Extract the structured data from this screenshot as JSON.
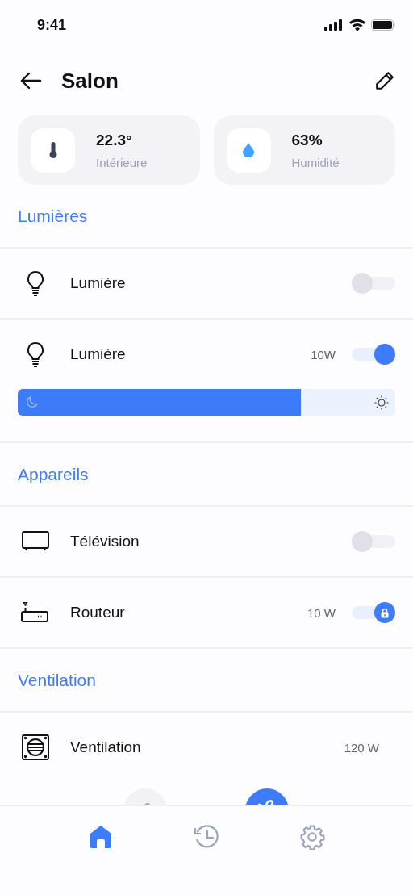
{
  "status_bar": {
    "time": "9:41"
  },
  "header": {
    "title": "Salon"
  },
  "stats": [
    {
      "kind": "temperature",
      "value": "22.3°",
      "label": "Intérieure"
    },
    {
      "kind": "humidity",
      "value": "63%",
      "label": "Humidité"
    }
  ],
  "sections": [
    {
      "title": "Lumières",
      "devices": [
        {
          "kind": "light",
          "name": "Lumière",
          "on": false
        },
        {
          "kind": "light",
          "name": "Lumière",
          "power": "10W",
          "on": true,
          "brightness": {
            "level": 0.75
          }
        }
      ]
    },
    {
      "title": "Appareils",
      "devices": [
        {
          "kind": "tv",
          "name": "Télévision",
          "on": false
        },
        {
          "kind": "router",
          "name": "Routeur",
          "power": "10 W",
          "on": true,
          "locked": true
        }
      ]
    },
    {
      "title": "Ventilation",
      "devices": [
        {
          "kind": "vent",
          "name": "Ventilation",
          "power": "120 W",
          "fan_speeds": [
            {
              "selected": false
            },
            {
              "selected": true
            }
          ]
        }
      ]
    }
  ],
  "nav": [
    {
      "kind": "home",
      "selected": true
    },
    {
      "kind": "history",
      "selected": false
    },
    {
      "kind": "settings",
      "selected": false
    }
  ]
}
